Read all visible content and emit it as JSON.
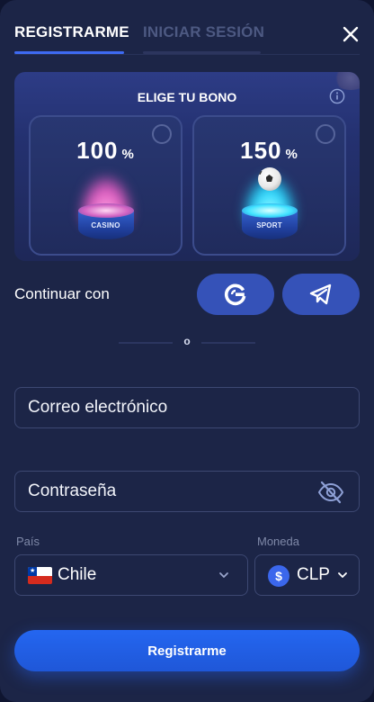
{
  "tabs": {
    "register": "REGISTRARME",
    "login": "INICIAR SESIÓN"
  },
  "bonus": {
    "title": "ELIGE TU BONO",
    "cards": [
      {
        "percent": "100",
        "suffix": "%",
        "badge": "CASINO"
      },
      {
        "percent": "150",
        "suffix": "%",
        "badge": "SPORT"
      }
    ]
  },
  "social": {
    "label": "Continuar con"
  },
  "separator": "o",
  "form": {
    "email_placeholder": "Correo electrónico",
    "password_placeholder": "Contraseña",
    "country_label": "País",
    "country_value": "Chile",
    "currency_label": "Moneda",
    "currency_symbol": "$",
    "currency_value": "CLP"
  },
  "submit_label": "Registrarme",
  "icons": {
    "close": "close-icon",
    "info": "info-icon",
    "google": "google-icon",
    "telegram": "telegram-icon",
    "eye_off": "eye-off-icon",
    "chevron": "chevron-down-icon",
    "flag": "chile-flag-icon"
  },
  "colors": {
    "background": "#1c2547",
    "accent": "#3e6af2",
    "social_button": "#3552b8",
    "submit": "#2466f0"
  }
}
